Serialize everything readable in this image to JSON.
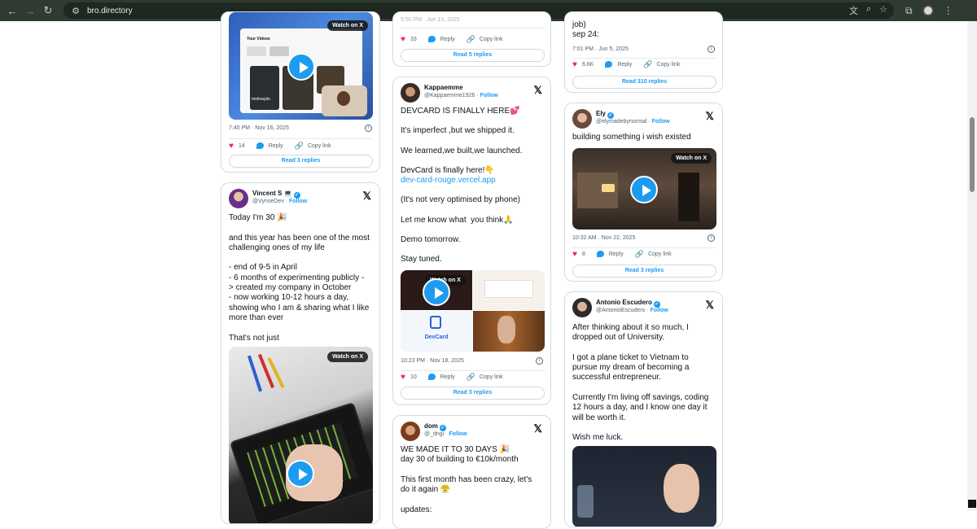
{
  "browser": {
    "url": "bro.directory"
  },
  "tweets": {
    "t1": {
      "watch": "Watch on X",
      "thumb_label": "Your Videos",
      "overlay_text": "motivação",
      "time": "7:40 PM · Nov 16, 2025",
      "likes": "14",
      "reply": "Reply",
      "copy": "Copy link",
      "replies": "Read 3 replies"
    },
    "t2": {
      "name": "Vincent S 💻",
      "handle": "@VynseDev",
      "follow": "Follow",
      "text": "Today I'm 30 🎉\n\nand this year has been one of the most challenging ones of my life\n\n- end of 9-5 in April\n- 6 months of experimenting publicly -\n> created my company in October\n- now working 10-12 hours a day, showing who I am & sharing what I like more than ever\n\nThat's not just",
      "watch": "Watch on X"
    },
    "t3": {
      "time": "5:50 PM · Jun 15, 2025",
      "likes": "33",
      "reply": "Reply",
      "copy": "Copy link",
      "replies": "Read 5 replies"
    },
    "t4": {
      "name": "Kappaemme",
      "handle": "@Kappaemme1926",
      "follow": "Follow",
      "p1": "DEVCARD IS FINALLY HERE💕",
      "p2": "It's imperfect ,but we shipped it.",
      "p3": "We learned,we built,we launched.",
      "p4": "DevCard is finally here!👇",
      "link": "dev-card-rouge.vercel.app",
      "p5": "(It's not very optimised by phone)",
      "p6": "Let me know what  you think🙏",
      "p7": "Demo tomorrow.",
      "p8": "Stay tuned.",
      "watch": "Watch on X",
      "devcard": "DevCard",
      "time": "10:23 PM · Nov 18, 2025",
      "likes": "10",
      "reply": "Reply",
      "copy": "Copy link",
      "replies": "Read 3 replies"
    },
    "t5": {
      "name": "dom",
      "handle": "@_dngi",
      "follow": "Follow",
      "text": "WE MADE IT TO 30 DAYS 🎉\nday 30 of building to €10k/month\n\nThis first month has been crazy, let's do it again 😤\n\nupdates:"
    },
    "t6": {
      "text_top": "job)\nsep 24:",
      "time": "7:01 PM · Jun 5, 2025",
      "likes": "6.6K",
      "reply": "Reply",
      "copy": "Copy link",
      "replies": "Read 310 replies"
    },
    "t7": {
      "name": "Ely",
      "handle": "@elymadebynormal",
      "follow": "Follow",
      "text": "building something i wish existed",
      "watch": "Watch on X",
      "time": "10:32 AM · Nov 22, 2025",
      "likes": "8",
      "reply": "Reply",
      "copy": "Copy link",
      "replies": "Read 3 replies"
    },
    "t8": {
      "name": "Antonio Escudero",
      "handle": "@AntonioEscudero",
      "follow": "Follow",
      "text": "After thinking about it so much, I dropped out of University.\n\nI got a plane ticket to Vietnam to pursue my dream of becoming a successful entrepreneur.\n\nCurrently I'm living off savings, coding 12 hours a day, and I know one day it will be worth it.\n\nWish me luck."
    }
  },
  "colors": {
    "accent": "#1d9bf0",
    "like": "#f91880",
    "chrome": "#2f3a31"
  },
  "icons": [
    "back-icon",
    "forward-icon",
    "reload-icon",
    "site-settings-icon",
    "translate-icon",
    "zoom-icon",
    "bookmark-star-icon",
    "extensions-icon",
    "profile-icon",
    "menu-icon",
    "x-logo-icon",
    "verified-icon",
    "heart-icon",
    "reply-icon",
    "link-icon",
    "info-icon",
    "play-icon"
  ]
}
